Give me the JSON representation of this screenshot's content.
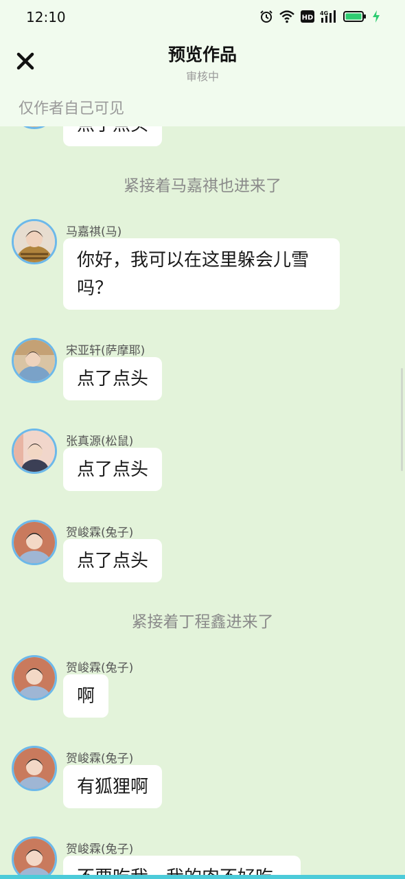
{
  "status_bar": {
    "time": "12:10",
    "icons": [
      "alarm-icon",
      "wifi-icon",
      "hd-icon",
      "4g-signal-icon",
      "battery-icon",
      "charging-icon"
    ],
    "hd_label": "HD",
    "network_label": "4G",
    "battery_color": "#2ecc71"
  },
  "header": {
    "title": "预览作品",
    "subtitle": "审核中",
    "visibility_note": "仅作者自己可见",
    "close_icon": "close-icon"
  },
  "chat": {
    "partial_top_bubble": "点了点头",
    "narration_1": "紧接着马嘉祺也进来了",
    "narration_2": "紧接着丁程鑫进来了",
    "messages": [
      {
        "sender": "马嘉祺(马)",
        "text_line1": "你好，我可以在这里躲会儿雪",
        "text_line2": "吗？"
      },
      {
        "sender": "宋亚轩(萨摩耶)",
        "text": "点了点头"
      },
      {
        "sender": "张真源(松鼠)",
        "text": "点了点头"
      },
      {
        "sender": "贺峻霖(兔子)",
        "text": "点了点头"
      },
      {
        "sender": "贺峻霖(兔子)",
        "text": "啊"
      },
      {
        "sender": "贺峻霖(兔子)",
        "text": "有狐狸啊"
      },
      {
        "sender": "贺峻霖(兔子)",
        "text": "不要吃我，我的肉不好吃"
      }
    ]
  },
  "colors": {
    "background": "#e3f3da",
    "header_bg": "#f1fbee",
    "avatar_border": "#6cb8ea",
    "bubble_bg": "#ffffff"
  }
}
